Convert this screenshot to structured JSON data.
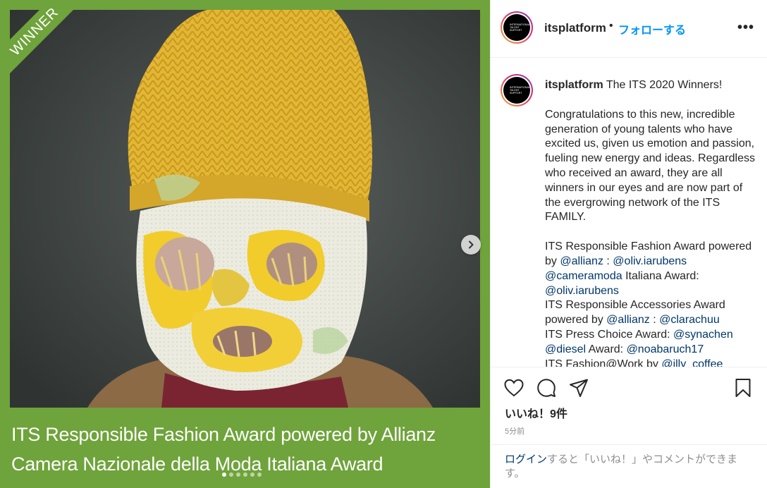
{
  "media": {
    "ribbon_text": "WINNER",
    "caption_line1": "ITS Responsible Fashion Award powered by Allianz",
    "caption_line2": "Camera Nazionale della Moda Italiana Award",
    "carousel": {
      "total": 6,
      "active": 0
    },
    "next_icon": "chevron-right-icon",
    "frame_color": "#6fa33b"
  },
  "header": {
    "avatar_text": "INTERNATIONAL TALENT SUPPORT",
    "username": "itsplatform",
    "separator": "•",
    "follow_label": "フォローする",
    "more_icon": "more-options-icon",
    "more_label": "•••"
  },
  "comment": {
    "avatar_text": "INTERNATIONAL TALENT SUPPORT",
    "username": "itsplatform",
    "headline": "The ITS 2020 Winners!",
    "paragraph": "Congratulations to this new, incredible generation of young talents who have excited us, given us emotion and passion, fueling new energy and ideas. Regardless who received an award, they are all winners in our eyes and are now part of the evergrowing network of the ITS FAMILY.",
    "awards": [
      {
        "a": "ITS Responsible Fashion Award powered by ",
        "m1": "@allianz",
        "b": " : ",
        "m2": "@oliv.iarubens"
      },
      {
        "a": "",
        "m1": "@cameramoda",
        "b": " Italiana Award: ",
        "m2": "@oliv.iarubens"
      },
      {
        "a": "ITS Responsible Accessories Award powered by ",
        "m1": "@allianz",
        "b": " : ",
        "m2": "@clarachuu"
      },
      {
        "a": "ITS Press Choice Award: ",
        "m1": "@synachen",
        "b": "",
        "m2": ""
      },
      {
        "a": "",
        "m1": "@diesel",
        "b": " Award: ",
        "m2": "@noabaruch17"
      },
      {
        "a": "ITS Fashion@Work by ",
        "m1": "@illy_coffee",
        "b": "",
        "m2": ""
      }
    ]
  },
  "actions": {
    "icons": [
      "heart-icon",
      "comment-icon",
      "share-icon",
      "bookmark-icon"
    ],
    "likes_text": "いいね！9件",
    "time_text": "5分前"
  },
  "footer": {
    "login_label": "ログイン",
    "rest_text": "すると「いいね！」やコメントができます。"
  }
}
